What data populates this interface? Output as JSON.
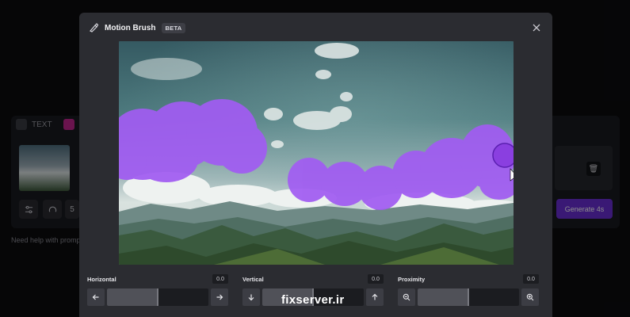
{
  "background_app": {
    "tabs": [
      {
        "label": "TEXT"
      },
      {
        "label": ""
      }
    ],
    "duration_value": "5",
    "help_text": "Need help with promp",
    "generate_label": "Generate 4s"
  },
  "modal": {
    "title": "Motion Brush",
    "badge": "BETA",
    "brush_color": "#9b59f0",
    "controls": {
      "horizontal": {
        "label": "Horizontal",
        "value": "0.0",
        "level": 0.5
      },
      "vertical": {
        "label": "Vertical",
        "value": "0.0",
        "level": 0.5
      },
      "proximity": {
        "label": "Proximity",
        "value": "0.0",
        "level": 0.5
      }
    }
  },
  "watermark": "fixserver.ir",
  "colors": {
    "accent": "#6b2fd6",
    "modal_bg": "#2b2c31"
  }
}
